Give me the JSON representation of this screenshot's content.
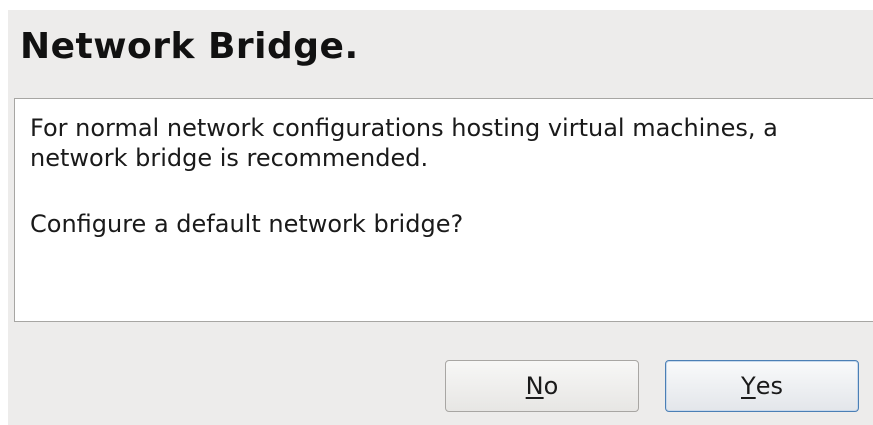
{
  "dialog": {
    "title": "Network Bridge.",
    "message": [
      "For normal network configurations hosting virtual machines, a network bridge is recommended.",
      "Configure a default network bridge?"
    ],
    "buttons": {
      "no": {
        "mnemonic": "N",
        "rest": "o"
      },
      "yes": {
        "mnemonic": "Y",
        "rest": "es"
      }
    }
  },
  "colors": {
    "dialog_background": "#edeceb",
    "message_background": "#ffffff",
    "default_button_border": "#4b7fb5"
  }
}
